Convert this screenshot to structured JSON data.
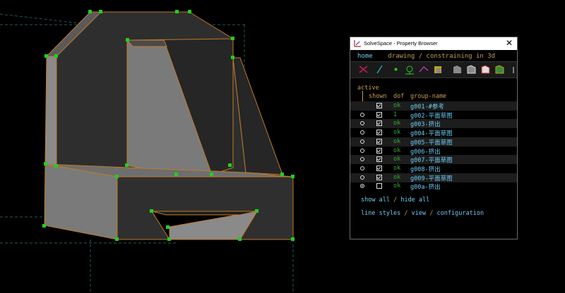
{
  "app": {
    "title": "SolveSpace - Property Browser",
    "close_glyph": "✕"
  },
  "nav": {
    "home": "home",
    "location": "drawing / constraining in 3d"
  },
  "toolbar": {
    "icons": [
      "line-style-icon",
      "workplane-icon",
      "point-icon",
      "constraint-icon",
      "dimension-icon",
      "shaded-solid-icon",
      "outline-solid-icon",
      "hidden-lines-icon",
      "mesh-icon",
      "faces-icon",
      "overflow-icon"
    ]
  },
  "groups": {
    "active_label": "active",
    "headers": {
      "shown": "shown",
      "dof": "dof",
      "name": "group-name"
    },
    "rows": [
      {
        "name": "g001-#参考",
        "dof": "ok",
        "shown": true,
        "active": false,
        "has_radio": false
      },
      {
        "name": "g002-平面草图",
        "dof": "1",
        "shown": true,
        "active": false,
        "has_radio": true
      },
      {
        "name": "g003-挤出",
        "dof": "ok",
        "shown": true,
        "active": false,
        "has_radio": true
      },
      {
        "name": "g004-平面草图",
        "dof": "ok",
        "shown": true,
        "active": false,
        "has_radio": true
      },
      {
        "name": "g005-平面草图",
        "dof": "ok",
        "shown": true,
        "active": false,
        "has_radio": true
      },
      {
        "name": "g006-挤出",
        "dof": "ok",
        "shown": true,
        "active": false,
        "has_radio": true
      },
      {
        "name": "g007-平面草图",
        "dof": "ok",
        "shown": true,
        "active": false,
        "has_radio": true
      },
      {
        "name": "g008-挤出",
        "dof": "ok",
        "shown": true,
        "active": false,
        "has_radio": true
      },
      {
        "name": "g009-平面草图",
        "dof": "ok",
        "shown": true,
        "active": false,
        "has_radio": true
      },
      {
        "name": "g00a-挤出",
        "dof": "ok",
        "shown": false,
        "active": true,
        "has_radio": true
      }
    ]
  },
  "links": {
    "show_all": "show all",
    "hide_all": "hide all",
    "line_styles": "line styles",
    "view": "view",
    "configuration": "configuration"
  },
  "colors": {
    "accent_cyan": "#6ecdf5",
    "accent_orange": "#c99a52",
    "ok_green": "#2fae2f",
    "point_green": "#1fd01f"
  }
}
